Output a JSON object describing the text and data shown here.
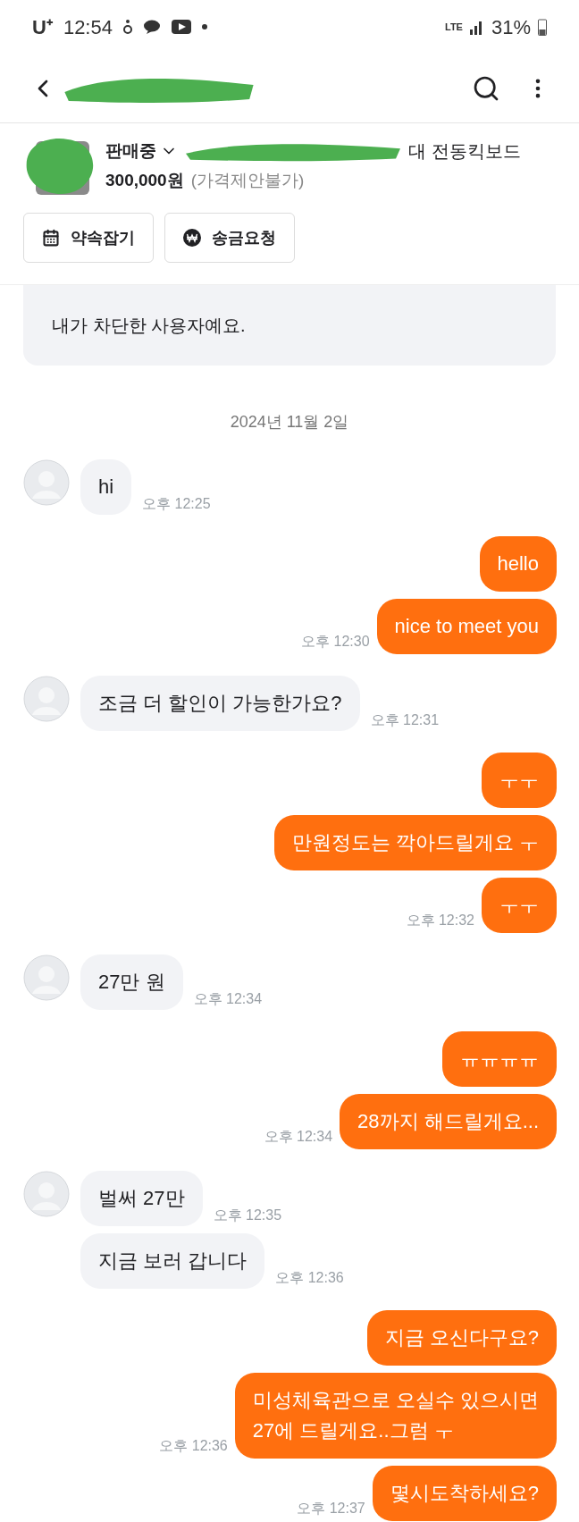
{
  "status_bar": {
    "carrier": "U⁺",
    "time": "12:54",
    "network": "LTE",
    "battery": "31%"
  },
  "product": {
    "status": "판매중",
    "title": "대 전동킥보드",
    "price": "300,000원",
    "price_note": "(가격제안불가)"
  },
  "actions": [
    {
      "kind": "calendar",
      "label": "약속잡기"
    },
    {
      "kind": "won",
      "label": "송금요청"
    }
  ],
  "notice": "내가 차단한 사용자예요.",
  "date": "2024년 11월 2일",
  "groups": [
    {
      "kind": "other",
      "messages": [
        {
          "text": "hi",
          "time": "오후 12:25"
        }
      ]
    },
    {
      "kind": "me",
      "messages": [
        {
          "text": "hello"
        },
        {
          "text": "nice to meet you",
          "time": "오후 12:30"
        }
      ]
    },
    {
      "kind": "other",
      "messages": [
        {
          "text": "조금 더 할인이 가능한가요?",
          "time": "오후 12:31"
        }
      ]
    },
    {
      "kind": "me",
      "messages": [
        {
          "text": "ㅜㅜ"
        },
        {
          "text": "만원정도는 깍아드릴게요 ㅜ"
        },
        {
          "text": "ㅜㅜ",
          "time": "오후 12:32"
        }
      ]
    },
    {
      "kind": "other",
      "messages": [
        {
          "text": "27만 원",
          "time": "오후 12:34"
        }
      ]
    },
    {
      "kind": "me",
      "messages": [
        {
          "text": "ㅠㅠㅠㅠ"
        },
        {
          "text": "28까지 해드릴게요...",
          "time": "오후 12:34"
        }
      ]
    },
    {
      "kind": "other",
      "messages": [
        {
          "text": "벌써 27만",
          "time": "오후 12:35"
        },
        {
          "text": "지금 보러 갑니다",
          "time": "오후 12:36"
        }
      ]
    },
    {
      "kind": "me",
      "messages": [
        {
          "text": "지금 오신다구요?"
        },
        {
          "text": "미성체육관으로 오실수 있으시면\n27에 드릴게요..그럼 ㅜ",
          "time": "오후 12:36"
        },
        {
          "text": "몇시도착하세요?",
          "time": "오후 12:37"
        }
      ]
    }
  ]
}
